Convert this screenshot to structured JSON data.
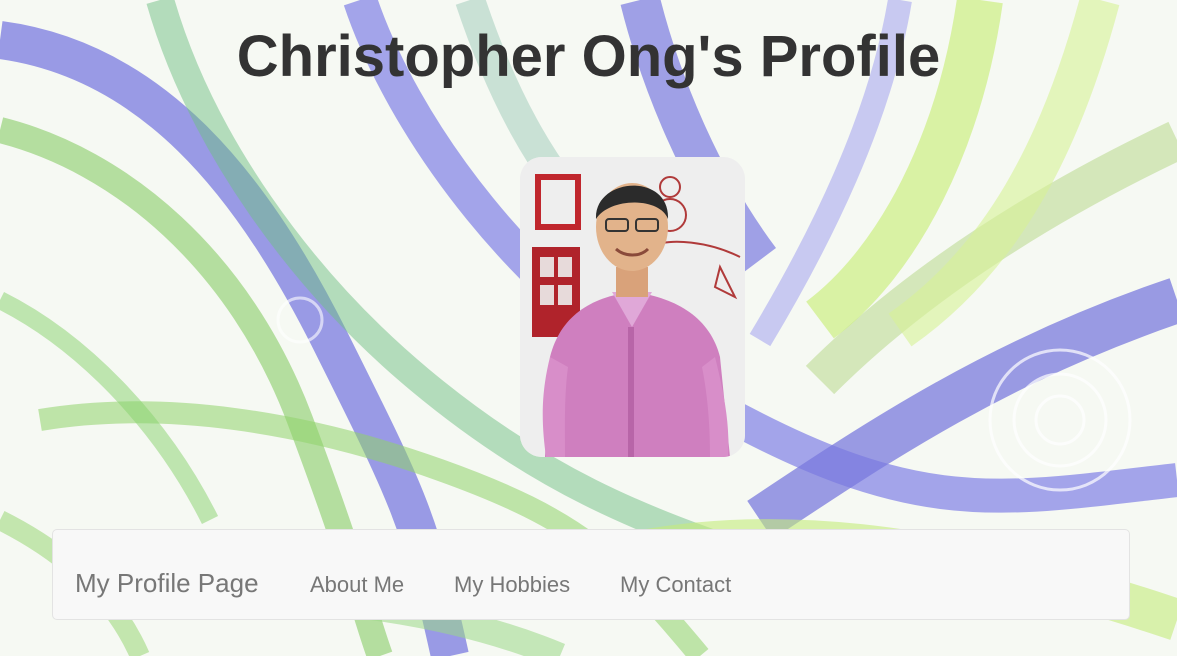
{
  "header": {
    "title": "Christopher Ong's Profile"
  },
  "profile": {
    "avatar_icon": "profile-photo"
  },
  "navbar": {
    "brand": "My Profile Page",
    "links": [
      {
        "label": "About Me"
      },
      {
        "label": "My Hobbies"
      },
      {
        "label": "My Contact"
      }
    ]
  },
  "colors": {
    "title": "#333333",
    "nav_text": "#777777",
    "navbar_bg": "#f8f8f8",
    "swirl_blue": "#7f7fe6",
    "swirl_green": "#8fd46a",
    "swirl_yellowgreen": "#c9ee7a"
  }
}
